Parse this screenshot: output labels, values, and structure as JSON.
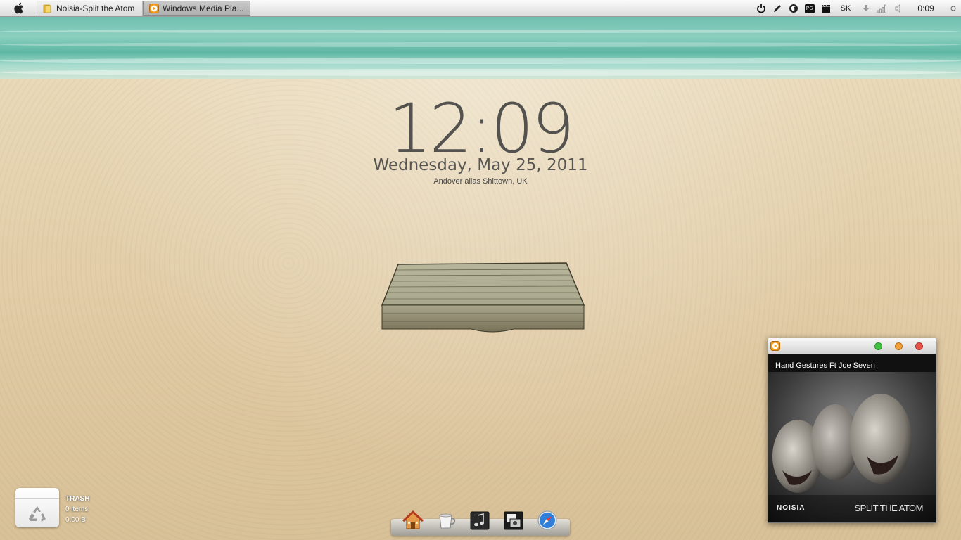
{
  "menubar": {
    "tasks": [
      {
        "label": "Noisia-Split the Atom",
        "icon": "folder-icon"
      },
      {
        "label": "Windows Media Pla...",
        "icon": "media-player-icon"
      }
    ],
    "tray": {
      "keyboard_layout": "SK",
      "ps_label": "PS",
      "clock": "0:09"
    }
  },
  "desktop": {
    "time": "12:09",
    "date": "Wednesday, May 25, 2011",
    "location": "Andover alias Shittown, UK"
  },
  "trash": {
    "title": "TRASH",
    "items": "0 items",
    "size": "0.00 B"
  },
  "dock": {
    "icons": [
      "home-icon",
      "coffee-cup-icon",
      "music-icon",
      "photos-icon",
      "safari-compass-icon"
    ]
  },
  "player": {
    "track": "Hand Gestures Ft Joe Seven",
    "album_logo": "NOISIA",
    "album_title": "SPLIT THE ATOM",
    "window_buttons": {
      "green": "#3fc23f",
      "orange": "#f2a23a",
      "red": "#e8534a"
    }
  }
}
